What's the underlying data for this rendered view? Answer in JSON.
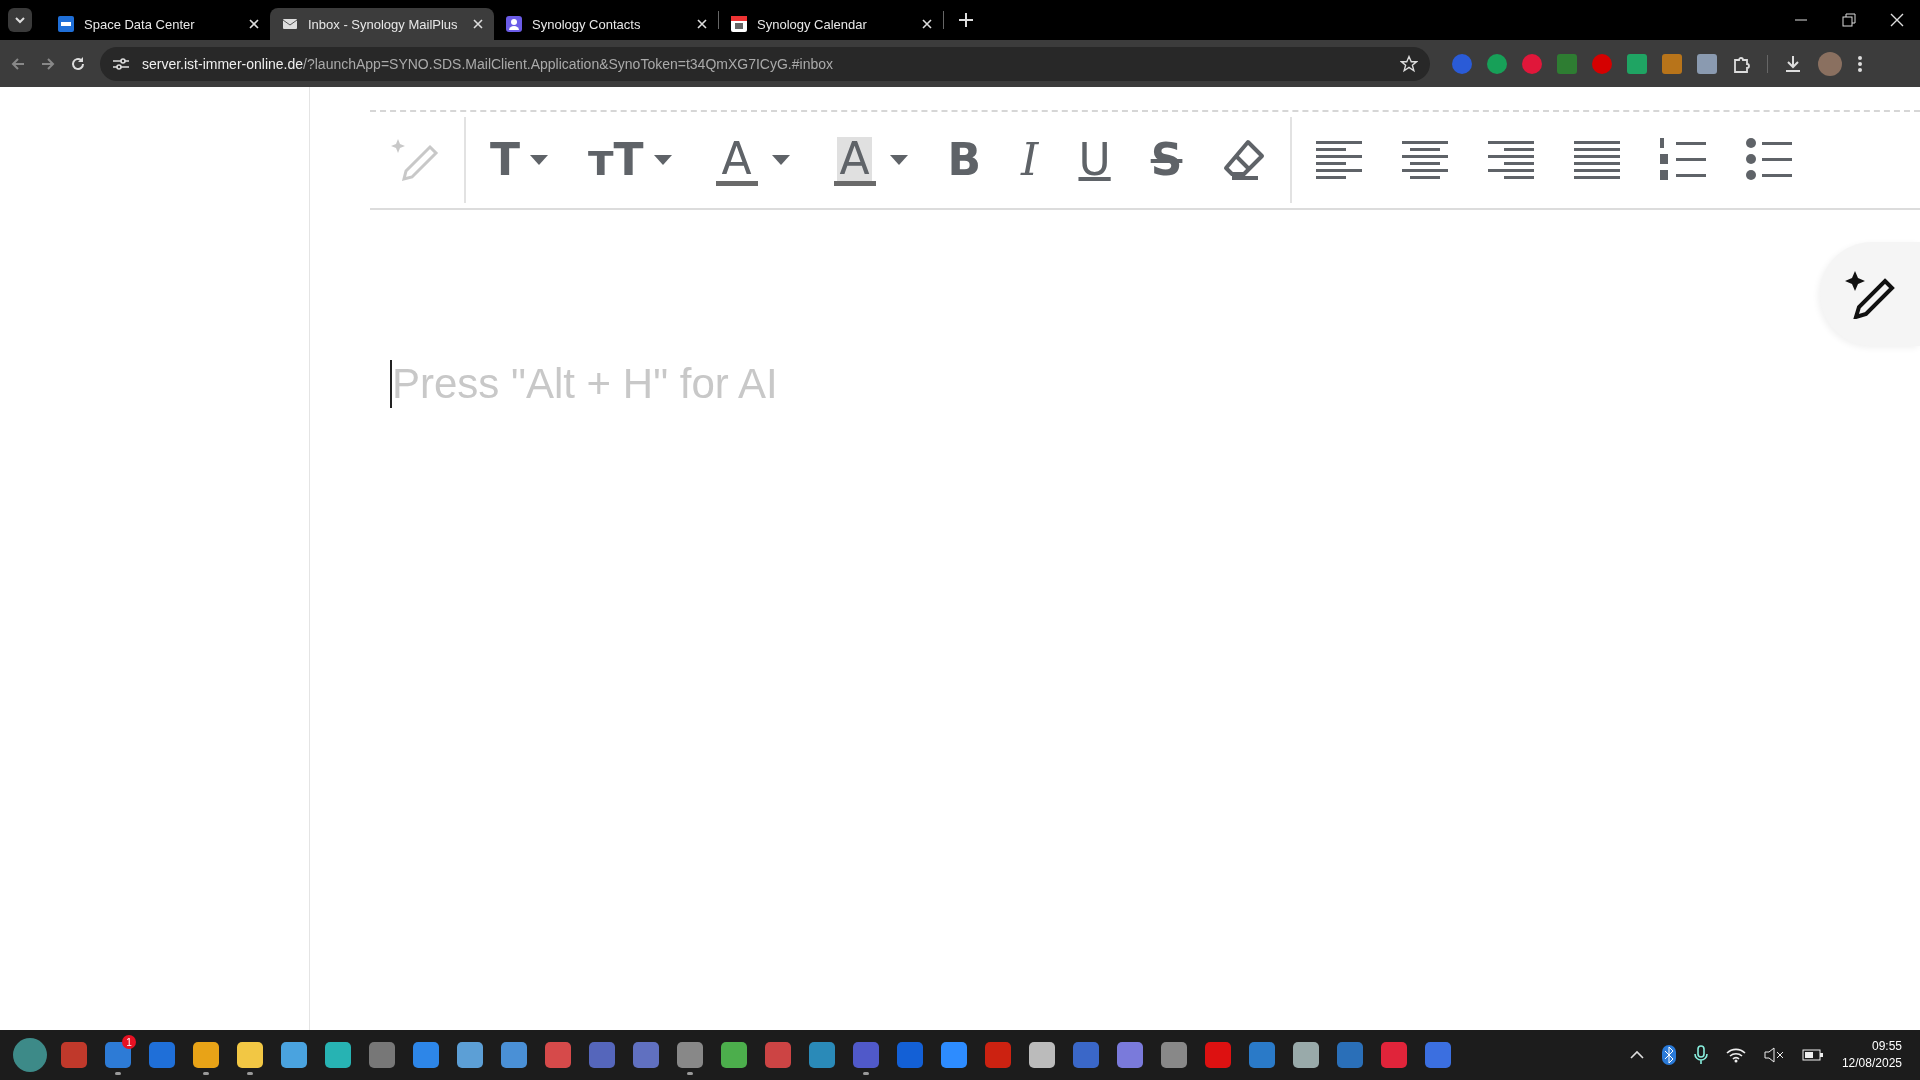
{
  "browser": {
    "tabs": [
      {
        "title": "Space Data Center",
        "selected": false
      },
      {
        "title": "Inbox - Synology MailPlus",
        "selected": true
      },
      {
        "title": "Synology Contacts",
        "selected": false
      },
      {
        "title": "Synology Calendar",
        "selected": false
      }
    ],
    "address": {
      "host": "server.ist-immer-online.de",
      "path": "/?launchApp=SYNO.SDS.MailClient.Application&SynoToken=t34QmXG7ICyG.#inbox"
    }
  },
  "editor": {
    "toolbar": [
      {
        "kind": "ai"
      },
      {
        "kind": "sep"
      },
      {
        "kind": "font",
        "label": "T"
      },
      {
        "kind": "font-size",
        "label": "тT"
      },
      {
        "kind": "font-color",
        "label": "A",
        "color": "#6a6a6a"
      },
      {
        "kind": "highlight-color",
        "label": "A",
        "color": "#6a6a6a"
      },
      {
        "kind": "bold",
        "label": "B"
      },
      {
        "kind": "italic",
        "label": "I"
      },
      {
        "kind": "underline",
        "label": "U"
      },
      {
        "kind": "strike",
        "label": "S"
      },
      {
        "kind": "eraser"
      },
      {
        "kind": "sep"
      },
      {
        "kind": "align-left"
      },
      {
        "kind": "align-center"
      },
      {
        "kind": "align-right"
      },
      {
        "kind": "justify"
      },
      {
        "kind": "ordered-list"
      },
      {
        "kind": "bullet-list"
      }
    ],
    "placeholder": "Press \"Alt + H\" for AI"
  },
  "taskbar": {
    "apps": [
      {
        "running": false
      },
      {
        "running": false
      },
      {
        "running": true,
        "badge": "1"
      },
      {
        "running": false
      },
      {
        "running": true
      },
      {
        "running": true
      },
      {
        "running": false
      },
      {
        "running": false
      },
      {
        "running": false
      },
      {
        "running": false
      },
      {
        "running": false
      },
      {
        "running": false
      },
      {
        "running": false
      },
      {
        "running": false
      },
      {
        "running": false
      },
      {
        "running": true
      },
      {
        "running": false
      },
      {
        "running": false
      },
      {
        "running": false
      },
      {
        "running": true
      },
      {
        "running": false
      },
      {
        "running": false
      },
      {
        "running": false
      },
      {
        "running": false
      },
      {
        "running": false
      },
      {
        "running": false
      },
      {
        "running": false
      },
      {
        "running": false
      },
      {
        "running": false
      },
      {
        "running": false
      },
      {
        "running": false
      },
      {
        "running": false
      },
      {
        "running": false
      }
    ],
    "time": "09:55",
    "date": "12/08/2025"
  }
}
